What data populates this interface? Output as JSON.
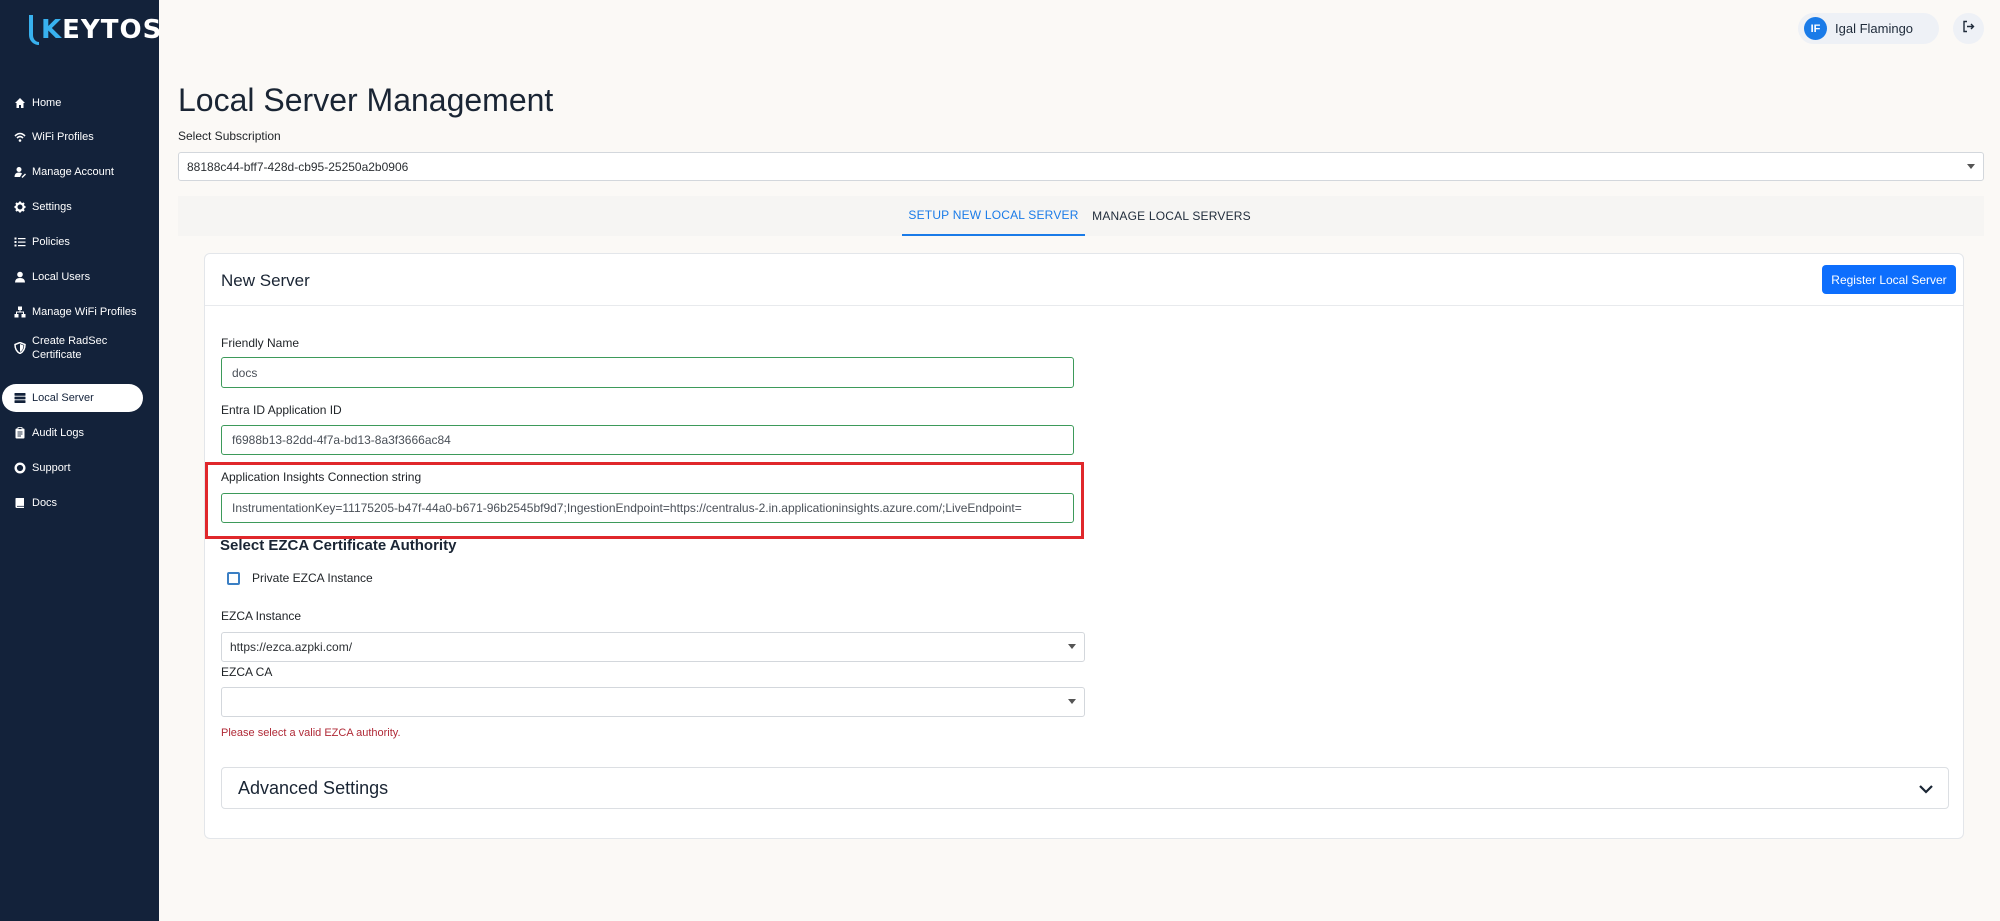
{
  "brand": {
    "logo_text": "KEYTOS",
    "logo_first_letter": "K",
    "logo_rest": "EYTOS"
  },
  "sidebar": {
    "items": [
      {
        "label": "Home",
        "icon": "home-icon"
      },
      {
        "label": "WiFi Profiles",
        "icon": "wifi-icon"
      },
      {
        "label": "Manage Account",
        "icon": "user-edit-icon"
      },
      {
        "label": "Settings",
        "icon": "gear-icon"
      },
      {
        "label": "Policies",
        "icon": "list-icon"
      },
      {
        "label": "Local Users",
        "icon": "user-icon"
      },
      {
        "label": "Manage WiFi Profiles",
        "icon": "sitemap-icon"
      },
      {
        "label": "Create RadSec Certificate",
        "icon": "shield-icon"
      },
      {
        "label": "Local Server",
        "icon": "server-icon",
        "active": true
      },
      {
        "label": "Audit Logs",
        "icon": "clipboard-icon"
      },
      {
        "label": "Support",
        "icon": "lifebuoy-icon"
      },
      {
        "label": "Docs",
        "icon": "book-icon"
      }
    ]
  },
  "header": {
    "user_initials": "IF",
    "user_name": "Igal Flamingo",
    "logout_icon": "sign-out-icon"
  },
  "page": {
    "title": "Local Server Management",
    "subscription_label": "Select Subscription",
    "subscription_value": "88188c44-bff7-428d-cb95-25250a2b0906"
  },
  "tabs": {
    "setup": "SETUP NEW LOCAL SERVER",
    "manage": "MANAGE LOCAL SERVERS"
  },
  "form": {
    "card_title": "New Server",
    "register_button": "Register Local Server",
    "friendly_name_label": "Friendly Name",
    "friendly_name_value": "docs",
    "entra_label": "Entra ID Application ID",
    "entra_value": "f6988b13-82dd-4f7a-bd13-8a3f3666ac84",
    "insights_label": "Application Insights Connection string",
    "insights_value": "InstrumentationKey=11175205-b47f-44a0-b671-96b2545bf9d7;IngestionEndpoint=https://centralus-2.in.applicationinsights.azure.com/;LiveEndpoint=",
    "ezca_section_title": "Select EZCA Certificate Authority",
    "private_checkbox_label": "Private EZCA Instance",
    "ezca_instance_label": "EZCA Instance",
    "ezca_instance_value": "https://ezca.azpki.com/",
    "ezca_ca_label": "EZCA CA",
    "ezca_ca_value": "",
    "error_text": "Please select a valid EZCA authority.",
    "advanced_title": "Advanced Settings"
  },
  "colors": {
    "sidebar_bg": "#13223a",
    "accent": "#1a7be8",
    "button": "#0d6efd",
    "highlight": "#e0282b",
    "error": "#b02a37",
    "valid_border": "#3d9a5a"
  }
}
